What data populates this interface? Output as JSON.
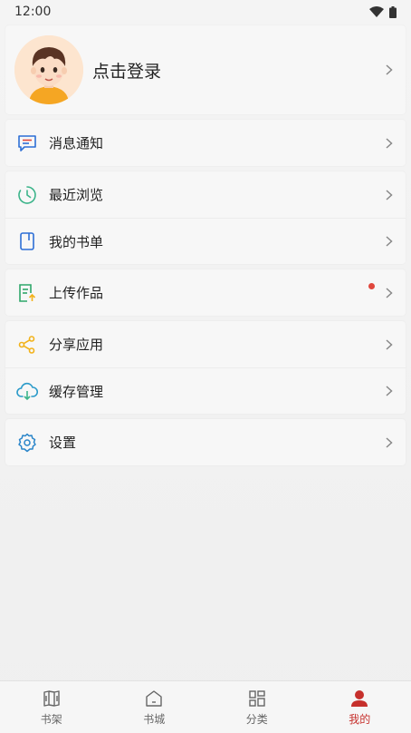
{
  "status_bar": {
    "time": "12:00"
  },
  "profile": {
    "login_label": "点击登录"
  },
  "menu_groups": [
    {
      "items": [
        {
          "label": "消息通知",
          "icon": "message-icon"
        }
      ]
    },
    {
      "items": [
        {
          "label": "最近浏览",
          "icon": "clock-icon"
        },
        {
          "label": "我的书单",
          "icon": "booklist-icon"
        }
      ]
    },
    {
      "items": [
        {
          "label": "上传作品",
          "icon": "upload-icon",
          "has_red_dot": true
        }
      ]
    },
    {
      "items": [
        {
          "label": "分享应用",
          "icon": "share-icon"
        },
        {
          "label": "缓存管理",
          "icon": "cloud-download-icon"
        }
      ]
    },
    {
      "items": [
        {
          "label": "设置",
          "icon": "gear-icon"
        }
      ]
    }
  ],
  "tabbar": {
    "tabs": [
      {
        "label": "书架",
        "icon": "bookshelf-icon",
        "active": false
      },
      {
        "label": "书城",
        "icon": "home-icon",
        "active": false
      },
      {
        "label": "分类",
        "icon": "category-icon",
        "active": false
      },
      {
        "label": "我的",
        "icon": "user-icon",
        "active": true
      }
    ]
  },
  "colors": {
    "accent_red": "#c6302c",
    "message_blue": "#2d6fd6",
    "clock_green": "#3cb48a",
    "upload_green": "#2fa76a",
    "share_yellow": "#f2b21a",
    "cloud_teal": "#2a9ac9",
    "gear_blue": "#2a85c9"
  }
}
